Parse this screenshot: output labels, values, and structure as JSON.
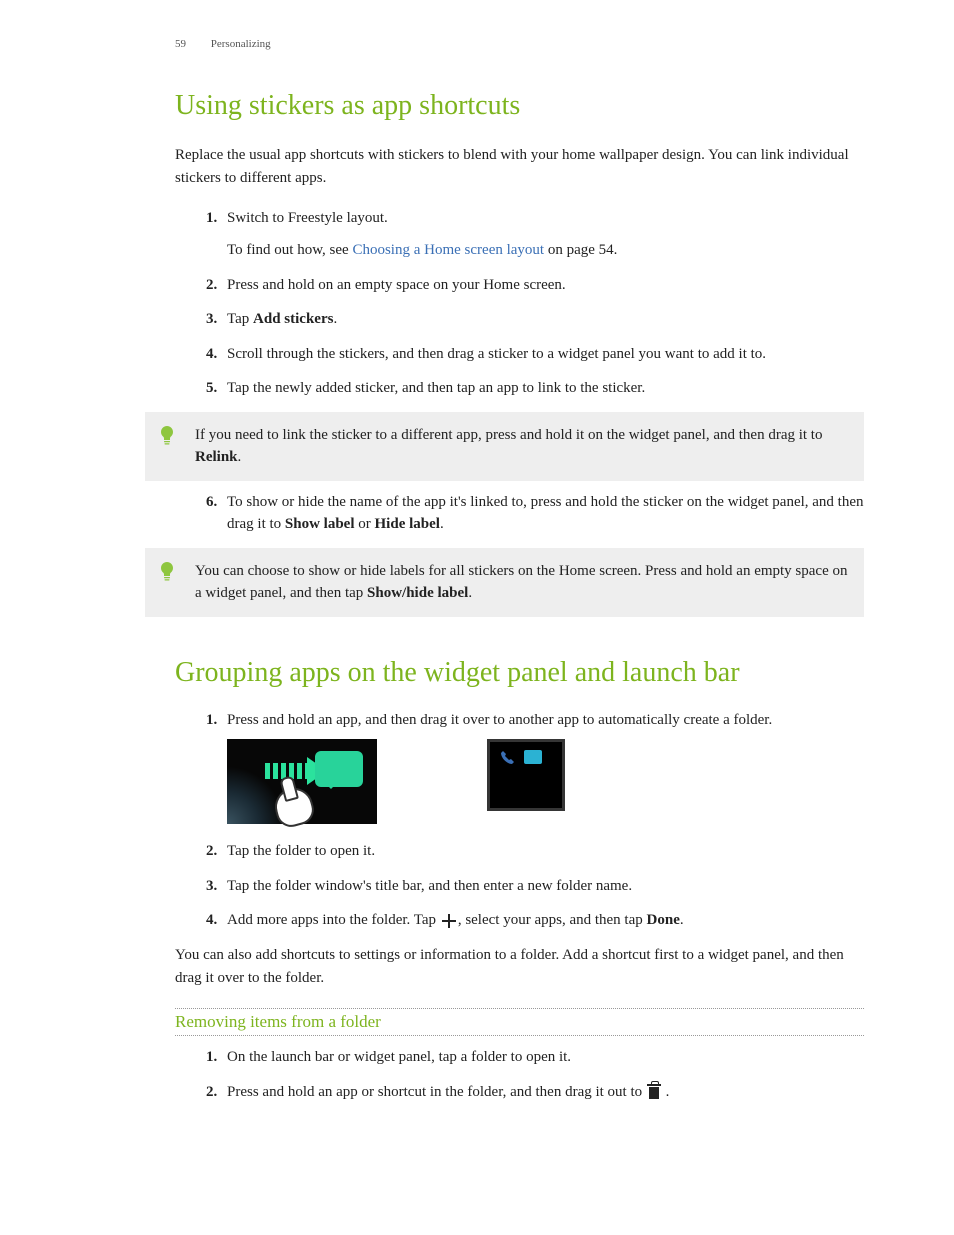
{
  "header": {
    "page_number": "59",
    "section": "Personalizing"
  },
  "section1": {
    "title": "Using stickers as app shortcuts",
    "intro": "Replace the usual app shortcuts with stickers to blend with your home wallpaper design. You can link individual stickers to different apps.",
    "steps": {
      "s1": "Switch to Freestyle layout.",
      "s1_sub_a": "To find out how, see ",
      "s1_link": "Choosing a Home screen layout",
      "s1_sub_b": " on page 54.",
      "s2": "Press and hold on an empty space on your Home screen.",
      "s3_a": "Tap ",
      "s3_bold": "Add stickers",
      "s3_b": ".",
      "s4": "Scroll through the stickers, and then drag a sticker to a widget panel you want to add it to.",
      "s5": "Tap the newly added sticker, and then tap an app to link to the sticker.",
      "s6_a": "To show or hide the name of the app it's linked to, press and hold the sticker on the widget panel, and then drag it to ",
      "s6_bold1": "Show label",
      "s6_mid": " or ",
      "s6_bold2": "Hide label",
      "s6_b": "."
    },
    "tip1_a": "If you need to link the sticker to a different app, press and hold it on the widget panel, and then drag it to ",
    "tip1_bold": "Relink",
    "tip1_b": ".",
    "tip2_a": "You can choose to show or hide labels for all stickers on the Home screen. Press and hold an empty space on a widget panel, and then tap ",
    "tip2_bold": "Show/hide label",
    "tip2_b": "."
  },
  "section2": {
    "title": "Grouping apps on the widget panel and launch bar",
    "steps": {
      "s1": "Press and hold an app, and then drag it over to another app to automatically create a folder.",
      "s2": "Tap the folder to open it.",
      "s3": "Tap the folder window's title bar, and then enter a new folder name.",
      "s4_a": "Add more apps into the folder. Tap ",
      "s4_b": ", select your apps, and then tap ",
      "s4_bold": "Done",
      "s4_c": "."
    },
    "para": "You can also add shortcuts to settings or information to a folder. Add a shortcut first to a widget panel, and then drag it over to the folder.",
    "sub": {
      "title": "Removing items from a folder",
      "s1": "On the launch bar or widget panel, tap a folder to open it.",
      "s2_a": "Press and hold an app or shortcut in the folder, and then drag it out to ",
      "s2_b": " ."
    }
  }
}
